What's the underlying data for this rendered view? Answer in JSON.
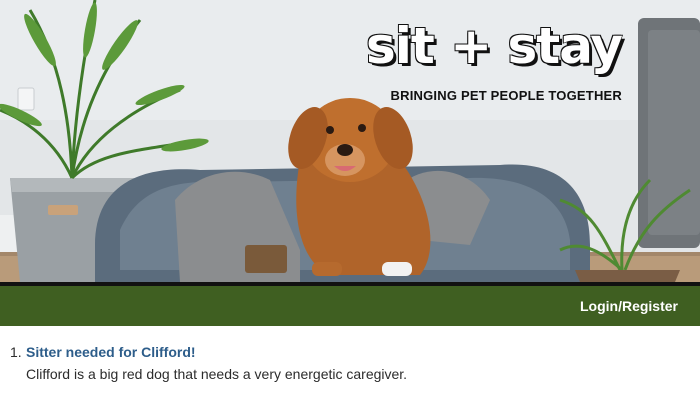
{
  "header": {
    "logo_text": "sit + stay",
    "tagline": "BRINGING PET PEOPLE TOGETHER"
  },
  "nav": {
    "login_label": "Login/Register"
  },
  "listings": [
    {
      "number": "1.",
      "title": "Sitter needed for Clifford!",
      "description": "Clifford is a big red dog that needs a very energetic caregiver."
    }
  ],
  "colors": {
    "nav_bar": "#3f5f21",
    "listing_title": "#2d5d8a"
  },
  "hero_image": {
    "subject": "dog-on-pet-bed-photo"
  }
}
